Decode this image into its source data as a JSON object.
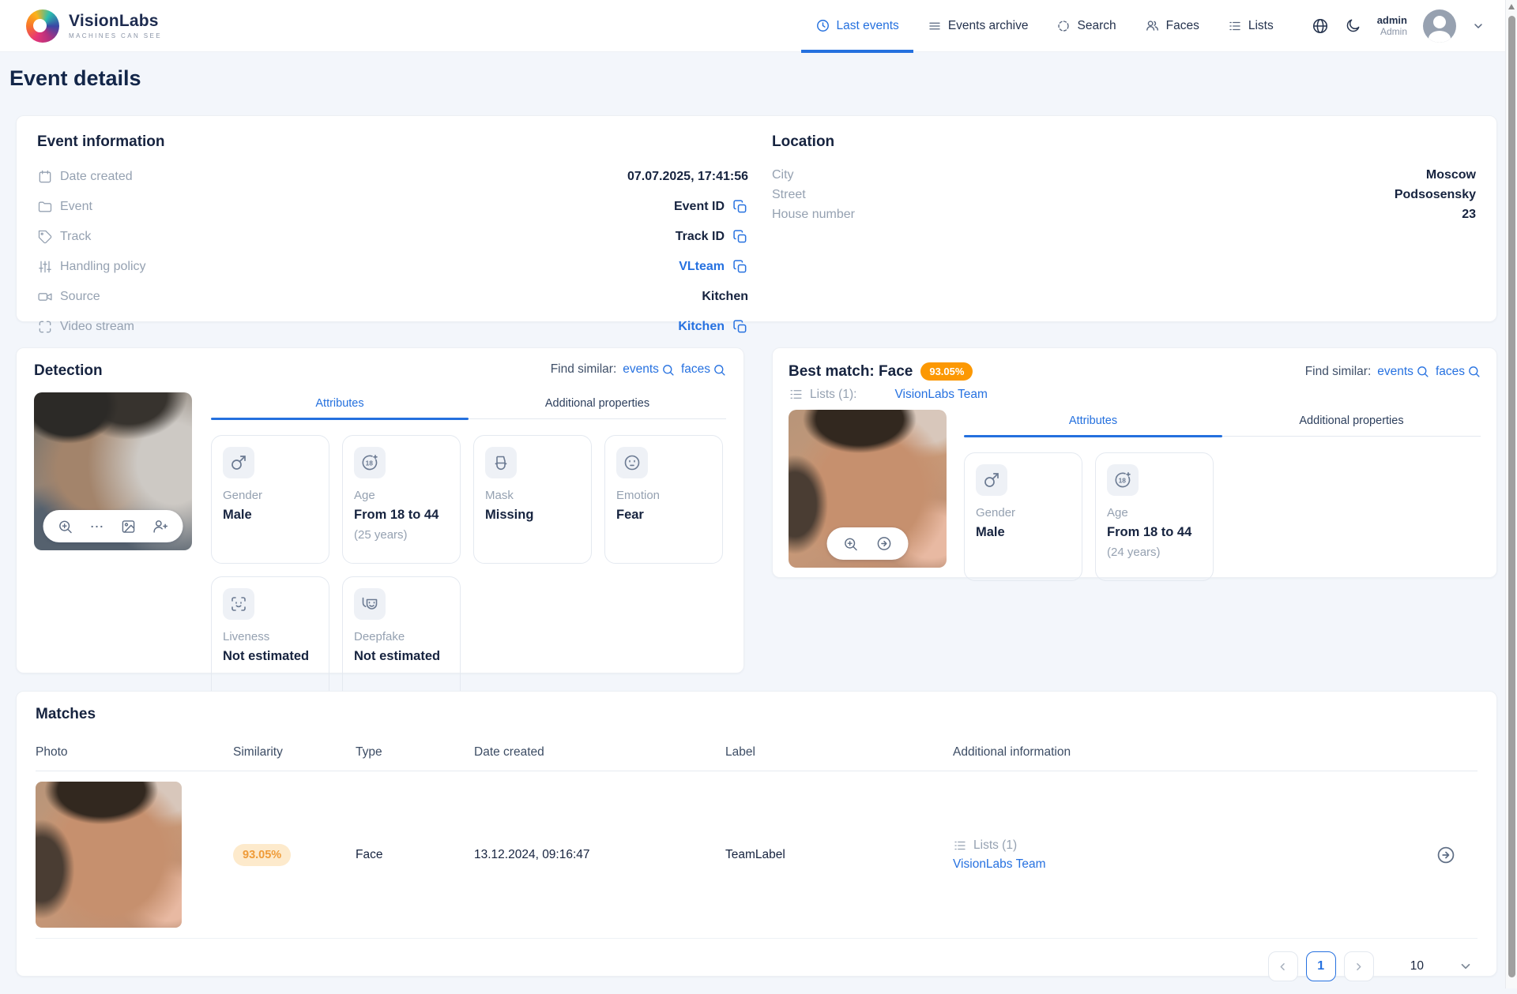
{
  "colors": {
    "accent": "#2470de",
    "link": "#2671e0",
    "badge_orange": "#fc9803",
    "similarity_bg": "#fdeacc",
    "similarity_text": "#ef9b38",
    "page_bg": "#f3f6fb"
  },
  "header": {
    "logo_title": "VisionLabs",
    "logo_subtitle": "MACHINES CAN SEE",
    "nav": [
      {
        "icon": "clock-icon",
        "label": "Last events",
        "active": true
      },
      {
        "icon": "menu-lines-icon",
        "label": "Events archive",
        "active": false
      },
      {
        "icon": "dashed-circle-icon",
        "label": "Search",
        "active": false
      },
      {
        "icon": "people-icon",
        "label": "Faces",
        "active": false
      },
      {
        "icon": "list-icon",
        "label": "Lists",
        "active": false
      }
    ],
    "tools": [
      "globe-icon",
      "moon-icon"
    ],
    "user": {
      "name": "admin",
      "role": "Admin"
    }
  },
  "page_title": "Event details",
  "event_information": {
    "title": "Event information",
    "rows": [
      {
        "icon": "calendar-icon",
        "label": "Date created",
        "value": "07.07.2025, 17:41:56",
        "kind": "text"
      },
      {
        "icon": "folder-icon",
        "label": "Event",
        "value": "Event ID",
        "kind": "copy"
      },
      {
        "icon": "tag-icon",
        "label": "Track",
        "value": "Track ID",
        "kind": "copy"
      },
      {
        "icon": "sliders-icon",
        "label": "Handling policy",
        "value": "VLteam",
        "kind": "link-copy"
      },
      {
        "icon": "video-camera-icon",
        "label": "Source",
        "value": "Kitchen",
        "kind": "text"
      },
      {
        "icon": "frame-corners-icon",
        "label": "Video stream",
        "value": "Kitchen",
        "kind": "link-copy"
      }
    ]
  },
  "location": {
    "title": "Location",
    "rows": [
      {
        "label": "City",
        "value": "Moscow"
      },
      {
        "label": "Street",
        "value": "Podsosensky"
      },
      {
        "label": "House number",
        "value": "23"
      }
    ]
  },
  "detection": {
    "title": "Detection",
    "find_similar": {
      "label": "Find similar:",
      "events": "events",
      "faces": "faces"
    },
    "tabs": [
      "Attributes",
      "Additional properties"
    ],
    "active_tab": "Attributes",
    "photo_tools": [
      "zoom-in-icon",
      "ellipsis-icon",
      "image-icon",
      "person-plus-icon"
    ],
    "attributes": [
      {
        "icon": "gender-male-icon",
        "label": "Gender",
        "value": "Male",
        "sub": ""
      },
      {
        "icon": "age-18-icon",
        "label": "Age",
        "value": "From 18 to 44",
        "sub": "(25 years)"
      },
      {
        "icon": "mask-icon",
        "label": "Mask",
        "value": "Missing",
        "sub": ""
      },
      {
        "icon": "emotion-face-icon",
        "label": "Emotion",
        "value": "Fear",
        "sub": ""
      },
      {
        "icon": "liveness-scan-icon",
        "label": "Liveness",
        "value": "Not estimated",
        "sub": ""
      },
      {
        "icon": "deepfake-masks-icon",
        "label": "Deepfake",
        "value": "Not estimated",
        "sub": ""
      }
    ]
  },
  "best_match": {
    "title": "Best match: Face",
    "badge": "93.05%",
    "lists_label": "Lists (1):",
    "lists_link": "VisionLabs Team",
    "find_similar": {
      "label": "Find similar:",
      "events": "events",
      "faces": "faces"
    },
    "tabs": [
      "Attributes",
      "Additional properties"
    ],
    "active_tab": "Attributes",
    "photo_tools": [
      "zoom-in-icon",
      "arrow-right-circle-icon"
    ],
    "attributes": [
      {
        "icon": "gender-male-icon",
        "label": "Gender",
        "value": "Male",
        "sub": ""
      },
      {
        "icon": "age-18-icon",
        "label": "Age",
        "value": "From 18 to 44",
        "sub": "(24 years)"
      }
    ]
  },
  "matches": {
    "title": "Matches",
    "columns": [
      "Photo",
      "Similarity",
      "Type",
      "Date created",
      "Label",
      "Additional information"
    ],
    "row": {
      "similarity": "93.05%",
      "type": "Face",
      "date": "13.12.2024, 09:16:47",
      "label": "TeamLabel",
      "lists_label": "Lists (1)",
      "lists_link": "VisionLabs Team"
    },
    "pagination": {
      "page": "1",
      "size": "10"
    }
  }
}
